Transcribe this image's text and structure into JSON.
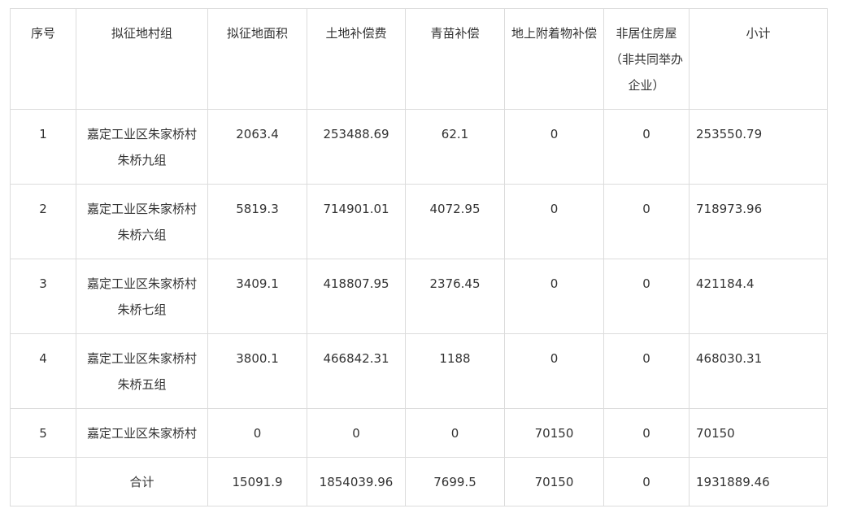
{
  "table": {
    "headers": [
      "序号",
      "拟征地村组",
      "拟征地面积",
      "土地补偿费",
      "青苗补偿",
      "地上附着物补偿",
      "非居住房屋（非共同举办企业）",
      "小计"
    ],
    "rows": [
      [
        "1",
        "嘉定工业区朱家桥村朱桥九组",
        "2063.4",
        "253488.69",
        "62.1",
        "0",
        "0",
        "253550.79"
      ],
      [
        "2",
        "嘉定工业区朱家桥村朱桥六组",
        "5819.3",
        "714901.01",
        "4072.95",
        "0",
        "0",
        "718973.96"
      ],
      [
        "3",
        "嘉定工业区朱家桥村朱桥七组",
        "3409.1",
        "418807.95",
        "2376.45",
        "0",
        "0",
        "421184.4"
      ],
      [
        "4",
        "嘉定工业区朱家桥村朱桥五组",
        "3800.1",
        "466842.31",
        "1188",
        "0",
        "0",
        "468030.31"
      ],
      [
        "5",
        "嘉定工业区朱家桥村",
        "0",
        "0",
        "0",
        "70150",
        "0",
        "70150"
      ],
      [
        "",
        "合计",
        "15091.9",
        "1854039.96",
        "7699.5",
        "70150",
        "0",
        "1931889.46"
      ]
    ]
  }
}
